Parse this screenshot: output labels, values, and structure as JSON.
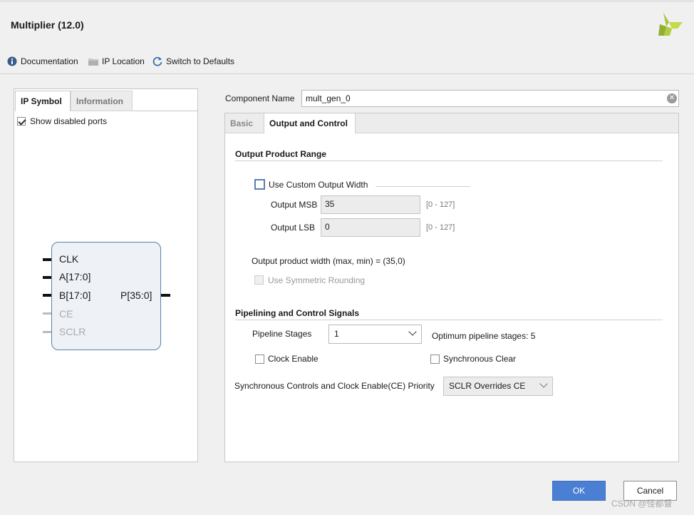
{
  "window": {
    "title": "Multiplier (12.0)"
  },
  "toolbar": {
    "documentation": "Documentation",
    "ip_location": "IP Location",
    "switch_defaults": "Switch to Defaults"
  },
  "left_panel": {
    "tabs": [
      "IP Symbol",
      "Information"
    ],
    "show_disabled_ports": "Show disabled ports",
    "show_disabled_checked": true,
    "ports_left": [
      "CLK",
      "A[17:0]",
      "B[17:0]",
      "CE",
      "SCLR"
    ],
    "ports_right": [
      "P[35:0]"
    ]
  },
  "component": {
    "label": "Component Name",
    "value": "mult_gen_0"
  },
  "config_tabs": [
    "Basic",
    "Output and Control"
  ],
  "output_range": {
    "title": "Output Product Range",
    "custom_width_label": "Use Custom Output Width",
    "custom_width_checked": false,
    "msb_label": "Output MSB",
    "msb_value": "35",
    "msb_range": "[0 - 127]",
    "lsb_label": "Output LSB",
    "lsb_value": "0",
    "lsb_range": "[0 - 127]",
    "product_width": "Output product width (max, min) = (35,0)",
    "symmetric_rounding": "Use Symmetric Rounding"
  },
  "pipelining": {
    "title": "Pipelining and Control Signals",
    "stages_label": "Pipeline Stages",
    "stages_value": "1",
    "optimum": "Optimum pipeline stages: 5",
    "clock_enable": "Clock Enable",
    "sync_clear": "Synchronous Clear",
    "priority_label": "Synchronous Controls and Clock Enable(CE) Priority",
    "priority_value": "SCLR Overrides CE"
  },
  "buttons": {
    "ok": "OK",
    "cancel": "Cancel"
  },
  "watermark": "CSDN @怪都督",
  "colors": {
    "accent": "#4a7fd4",
    "logo_green": "#a7c63f",
    "symbol_border": "#5a7fb0"
  }
}
